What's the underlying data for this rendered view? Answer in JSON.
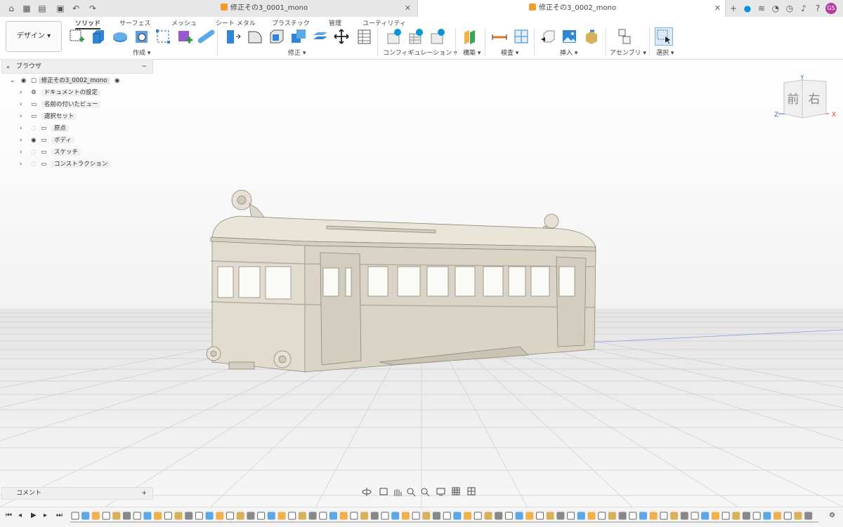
{
  "tabs": [
    {
      "label": "修正その3_0001_mono",
      "active": false
    },
    {
      "label": "修正その3_0002_mono",
      "active": true
    }
  ],
  "user_initials": "GS",
  "workspace": {
    "label": "デザイン"
  },
  "categories": [
    "ソリッド",
    "サーフェス",
    "メッシュ",
    "シート メタル",
    "プラスチック",
    "管理",
    "ユーティリティ"
  ],
  "groups": {
    "create": "作成",
    "modify": "修正",
    "config": "コンフィギュレーション",
    "construct": "構築",
    "inspect": "検査",
    "insert": "挿入",
    "assemble": "アセンブリ",
    "select": "選択"
  },
  "browser": {
    "title": "ブラウザ",
    "root": "修正その3_0002_mono",
    "items": [
      {
        "label": "ドキュメントの設定",
        "icon": "gear-icon"
      },
      {
        "label": "名前の付いたビュー",
        "icon": "folder-icon"
      },
      {
        "label": "選択セット",
        "icon": "folder-icon"
      },
      {
        "label": "原点",
        "icon": "folder-icon",
        "visibility": "hidden"
      },
      {
        "label": "ボディ",
        "icon": "folder-icon",
        "visibility": "visible"
      },
      {
        "label": "スケッチ",
        "icon": "folder-icon",
        "visibility": "hidden"
      },
      {
        "label": "コンストラクション",
        "icon": "folder-icon",
        "visibility": "hidden"
      }
    ]
  },
  "viewcube": {
    "front": "前",
    "right": "右",
    "x": "X",
    "y": "Y",
    "z": "Z"
  },
  "comments": {
    "label": "コメント"
  },
  "colors": {
    "accent": "#0696d7",
    "tab_orange": "#f39c2c",
    "avatar": "#b43ca0",
    "model": "#ddd8cb"
  }
}
